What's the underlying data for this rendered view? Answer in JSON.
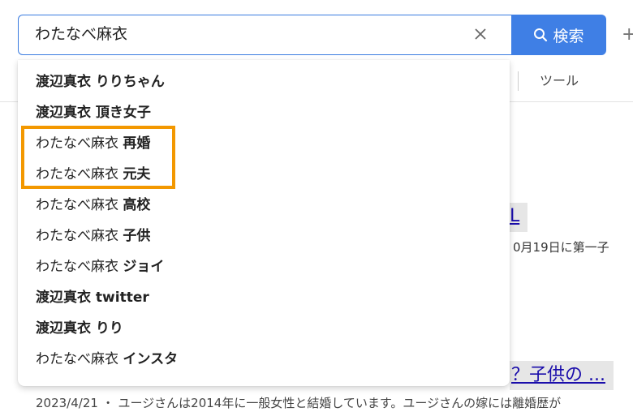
{
  "search": {
    "query": "わたなべ麻衣",
    "button_label": "検索"
  },
  "toolbar": {
    "tools_label": "ツール"
  },
  "suggestions": [
    {
      "prefix": "",
      "bold": "渡辺真衣 りりちゃん"
    },
    {
      "prefix": "",
      "bold": "渡辺真衣 頂き女子"
    },
    {
      "prefix": "わたなべ麻衣 ",
      "bold": "再婚"
    },
    {
      "prefix": "わたなべ麻衣 ",
      "bold": "元夫"
    },
    {
      "prefix": "わたなべ麻衣 ",
      "bold": "高校"
    },
    {
      "prefix": "わたなべ麻衣 ",
      "bold": "子供"
    },
    {
      "prefix": "わたなべ麻衣 ",
      "bold": "ジョイ"
    },
    {
      "prefix": "",
      "bold": "渡辺真衣 twitter"
    },
    {
      "prefix": "",
      "bold": "渡辺真衣 りり"
    },
    {
      "prefix": "わたなべ麻衣 ",
      "bold": "インスタ"
    }
  ],
  "results": {
    "title_1_fragment": "L",
    "snippet_1_fragment": "0月19日に第一子",
    "title_2_fragment": "？子供の ...",
    "snippet_2": "2023/4/21 ・ ユージさんは2014年に一般女性と結婚しています。ユージさんの嫁には離婚歴が"
  },
  "colors": {
    "accent": "#3f7fe5",
    "highlight": "#f39800"
  },
  "icons": {
    "clear": "close-icon",
    "search": "search-icon",
    "plus": "plus-icon"
  }
}
